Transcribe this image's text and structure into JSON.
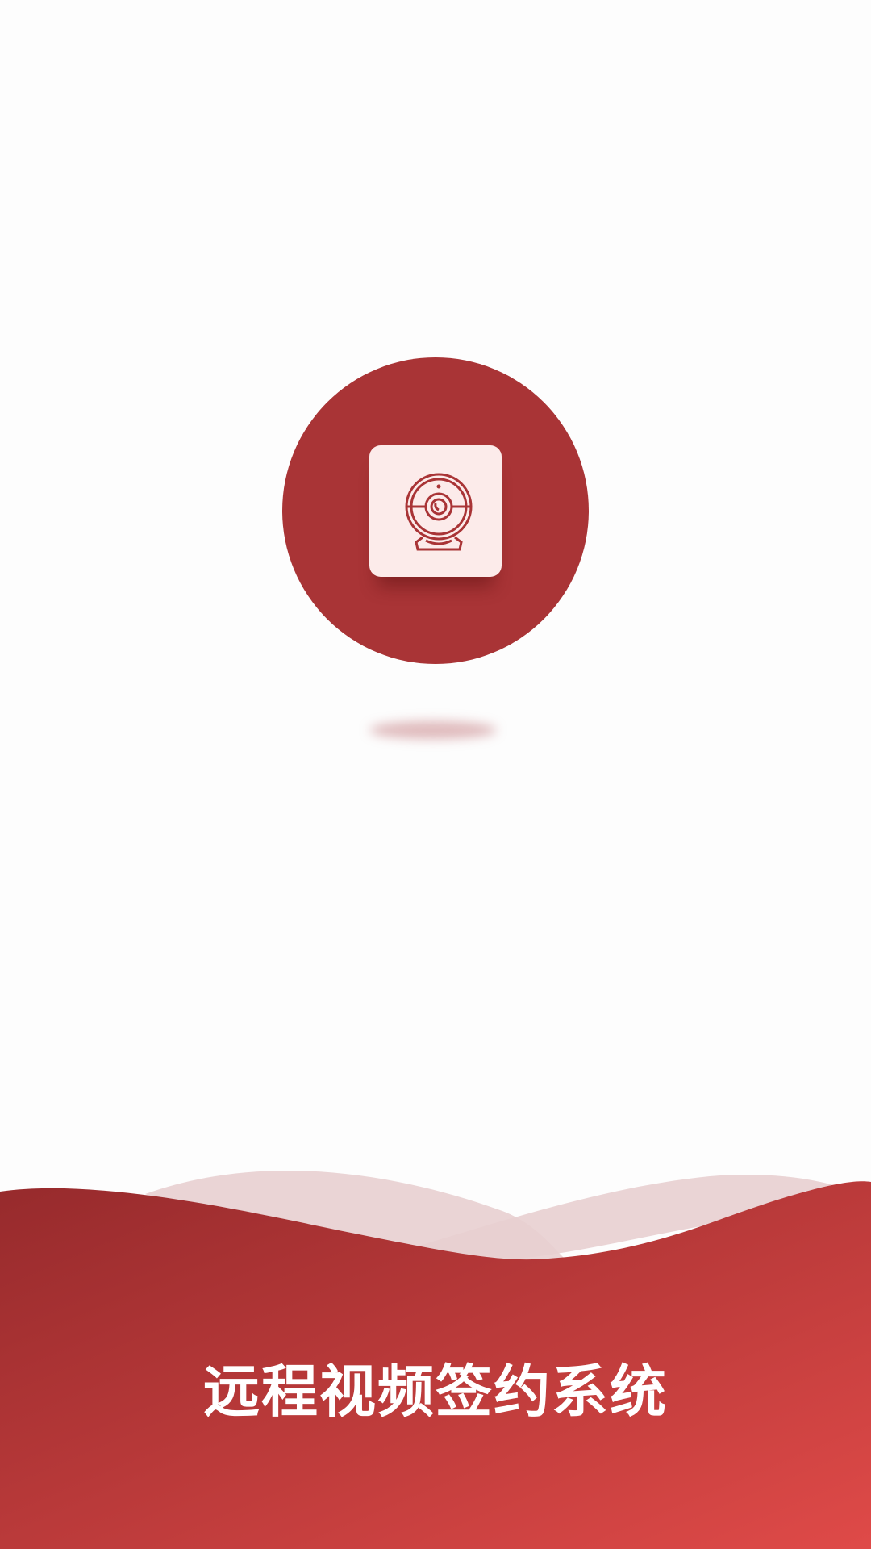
{
  "app": {
    "title": "远程视频签约系统"
  },
  "logo": {
    "icon": "webcam-icon"
  },
  "colors": {
    "background": "#fdfdfd",
    "brand_red": "#a93436",
    "tile_pink": "#fcebea",
    "wave_light": "#e8cfd0",
    "wave_gradient_start": "#962a2c",
    "wave_gradient_end": "#df4a48",
    "title_text": "#ffffff"
  }
}
